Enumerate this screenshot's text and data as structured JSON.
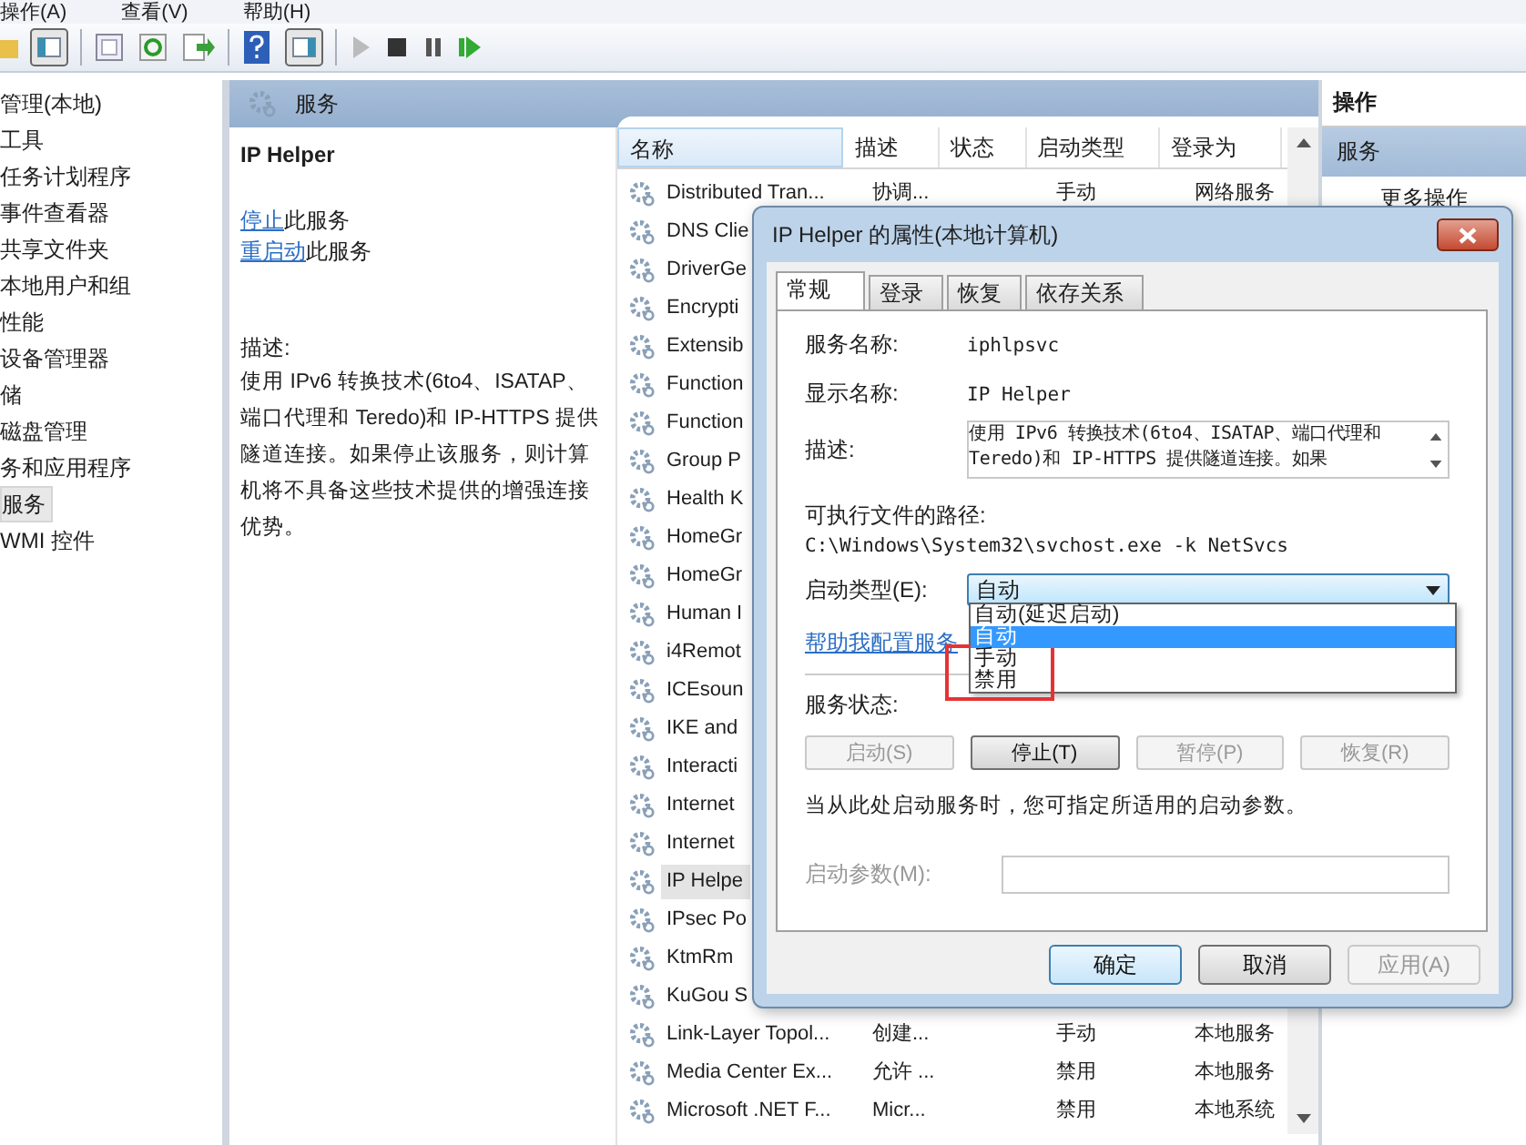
{
  "menubar": [
    {
      "label": "操作(A)"
    },
    {
      "label": "查看(V)"
    },
    {
      "label": "帮助(H)"
    }
  ],
  "tree": {
    "items": [
      {
        "label": "管理(本地)",
        "selected": false
      },
      {
        "label": "工具",
        "selected": false
      },
      {
        "label": "任务计划程序",
        "selected": false
      },
      {
        "label": "事件查看器",
        "selected": false
      },
      {
        "label": "共享文件夹",
        "selected": false
      },
      {
        "label": "本地用户和组",
        "selected": false
      },
      {
        "label": "性能",
        "selected": false
      },
      {
        "label": "设备管理器",
        "selected": false
      },
      {
        "label": "储",
        "selected": false
      },
      {
        "label": "磁盘管理",
        "selected": false
      },
      {
        "label": "务和应用程序",
        "selected": false
      },
      {
        "label": "服务",
        "selected": true
      },
      {
        "label": "WMI 控件",
        "selected": false
      }
    ]
  },
  "services_panel": {
    "title": "服务",
    "service_name": "IP Helper",
    "actions": [
      {
        "link": "停止",
        "text": "此服务"
      },
      {
        "link": "重启动",
        "text": "此服务"
      }
    ],
    "description_label": "描述:",
    "description": "使用 IPv6 转换技术(6to4、ISATAP、端口代理和 Teredo)和 IP-HTTPS 提供隧道连接。如果停止该服务，则计算机将不具备这些技术提供的增强连接优势。"
  },
  "table": {
    "columns": [
      "名称",
      "描述",
      "状态",
      "启动类型",
      "登录为"
    ],
    "rows": [
      {
        "name": "Distributed Tran...",
        "description": "协调...",
        "startup": "手动",
        "logon": "网络服务",
        "selected": false
      },
      {
        "name": "DNS Clie",
        "selected": false
      },
      {
        "name": "DriverGe",
        "selected": false
      },
      {
        "name": "Encrypti",
        "selected": false
      },
      {
        "name": "Extensib",
        "selected": false
      },
      {
        "name": "Function",
        "selected": false
      },
      {
        "name": "Function",
        "selected": false
      },
      {
        "name": "Group P",
        "selected": false
      },
      {
        "name": "Health K",
        "selected": false
      },
      {
        "name": "HomeGr",
        "selected": false
      },
      {
        "name": "HomeGr",
        "selected": false
      },
      {
        "name": "Human I",
        "selected": false
      },
      {
        "name": "i4Remot",
        "selected": false
      },
      {
        "name": "ICEsoun",
        "selected": false
      },
      {
        "name": "IKE and",
        "selected": false
      },
      {
        "name": "Interacti",
        "selected": false
      },
      {
        "name": "Internet",
        "selected": false
      },
      {
        "name": "Internet",
        "selected": false
      },
      {
        "name": "IP Helpe",
        "selected": true
      },
      {
        "name": "IPsec Po",
        "selected": false
      },
      {
        "name": "KtmRm",
        "selected": false
      },
      {
        "name": "KuGou S",
        "selected": false
      },
      {
        "name": "Link-Layer Topol...",
        "description": "创建...",
        "startup": "手动",
        "logon": "本地服务",
        "selected": false
      },
      {
        "name": "Media Center Ex...",
        "description": "允许 ...",
        "startup": "禁用",
        "logon": "本地服务",
        "selected": false
      },
      {
        "name": "Microsoft .NET F...",
        "description": "Micr...",
        "startup": "禁用",
        "logon": "本地系统",
        "selected": false
      }
    ]
  },
  "actions_pane": {
    "title": "操作",
    "section": "服务",
    "items": [
      "更多操作"
    ]
  },
  "dialog": {
    "title": "IP Helper 的属性(本地计算机)",
    "tabs": [
      {
        "label": "常规",
        "selected": true
      },
      {
        "label": "登录",
        "selected": false
      },
      {
        "label": "恢复",
        "selected": false
      },
      {
        "label": "依存关系",
        "selected": false
      }
    ],
    "service_name_label": "服务名称:",
    "service_name": "iphlpsvc",
    "display_name_label": "显示名称:",
    "display_name": "IP Helper",
    "description_label": "描述:",
    "description": "使用 IPv6 转换技术(6to4、ISATAP、端口代理和 Teredo)和 IP-HTTPS 提供隧道连接。如果",
    "path_label": "可执行文件的路径:",
    "path": "C:\\Windows\\System32\\svchost.exe -k NetSvcs",
    "startup_label": "启动类型(E):",
    "startup_value": "自动",
    "startup_options": [
      {
        "label": "自动(延迟启动)",
        "selected": false
      },
      {
        "label": "自动",
        "selected": true
      },
      {
        "label": "手动",
        "selected": false
      },
      {
        "label": "禁用",
        "selected": false
      }
    ],
    "help_link": "帮助我配置服务",
    "status_label": "服务状态:",
    "control_buttons": [
      {
        "label": "启动(S)",
        "disabled": true
      },
      {
        "label": "停止(T)",
        "disabled": false
      },
      {
        "label": "暂停(P)",
        "disabled": true
      },
      {
        "label": "恢复(R)",
        "disabled": true
      }
    ],
    "hint": "当从此处启动服务时，您可指定所适用的启动参数。",
    "params_label": "启动参数(M):",
    "params_disabled": true,
    "buttons": [
      {
        "label": "确定",
        "disabled": false
      },
      {
        "label": "取消",
        "disabled": false
      },
      {
        "label": "应用(A)",
        "disabled": true
      }
    ]
  }
}
